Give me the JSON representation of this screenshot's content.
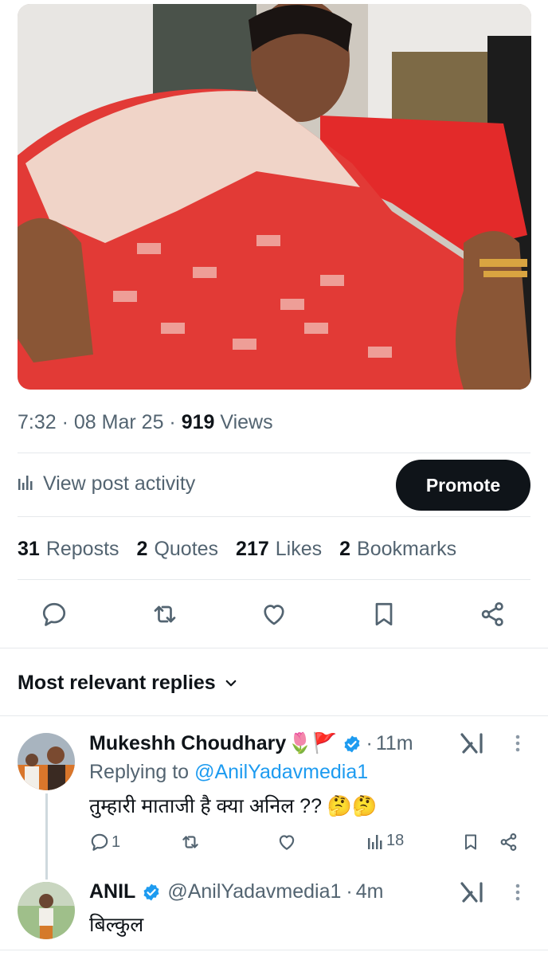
{
  "post": {
    "time": "7:32",
    "date": "08 Mar 25",
    "views_count": "919",
    "views_label": "Views",
    "activity_label": "View post activity",
    "promote_label": "Promote"
  },
  "stats": {
    "reposts_count": "31",
    "reposts_label": "Reposts",
    "quotes_count": "2",
    "quotes_label": "Quotes",
    "likes_count": "217",
    "likes_label": "Likes",
    "bookmarks_count": "2",
    "bookmarks_label": "Bookmarks"
  },
  "replies_header": "Most relevant replies",
  "replies": [
    {
      "name": "Mukeshh Choudhary",
      "emoji": "🌷🚩",
      "time": "11m",
      "replying_prefix": "Replying to",
      "replying_handle": "@AnilYadavmedia1",
      "text": "तुम्हारी माताजी है क्या अनिल ?? 🤔🤔",
      "reply_count": "1",
      "views": "18"
    },
    {
      "name": "ANIL",
      "handle": "@AnilYadavmedia1",
      "time": "4m",
      "text": "बिल्कुल"
    }
  ],
  "colors": {
    "accent": "#1d9bf0",
    "text": "#0f1419",
    "muted": "#536471",
    "divider": "#e6e9ec"
  }
}
